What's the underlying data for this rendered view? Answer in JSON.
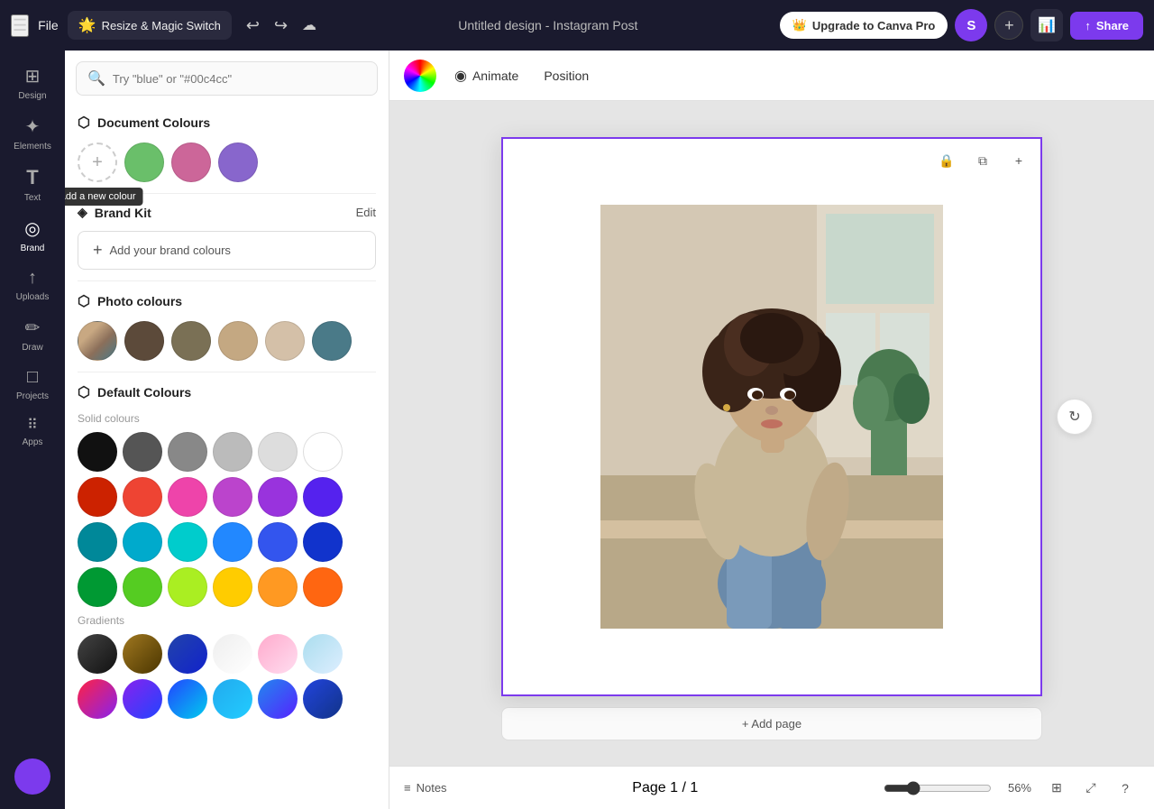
{
  "topbar": {
    "hamburger": "☰",
    "file_label": "File",
    "magic_switch_label": "Resize & Magic Switch",
    "magic_switch_emoji": "🌟",
    "undo_icon": "↩",
    "redo_icon": "↪",
    "cloud_icon": "☁",
    "title": "Untitled design - Instagram Post",
    "upgrade_label": "Upgrade to Canva Pro",
    "upgrade_crown": "👑",
    "avatar_letter": "S",
    "plus_icon": "+",
    "analytics_icon": "📊",
    "share_icon": "↑",
    "share_label": "Share"
  },
  "sidebar": {
    "items": [
      {
        "id": "design",
        "icon": "⊞",
        "label": "Design"
      },
      {
        "id": "elements",
        "icon": "✦",
        "label": "Elements"
      },
      {
        "id": "text",
        "icon": "T",
        "label": "Text"
      },
      {
        "id": "brand",
        "icon": "◎",
        "label": "Brand"
      },
      {
        "id": "uploads",
        "icon": "↑",
        "label": "Uploads"
      },
      {
        "id": "draw",
        "icon": "✏",
        "label": "Draw"
      },
      {
        "id": "projects",
        "icon": "□",
        "label": "Projects"
      },
      {
        "id": "apps",
        "icon": "⋮⋮",
        "label": "Apps"
      }
    ]
  },
  "color_panel": {
    "search_placeholder": "Try \"blue\" or \"#00c4cc\"",
    "document_colours_label": "Document Colours",
    "document_colors": [
      {
        "id": "dc1",
        "color": "#6abf6a",
        "label": "Green"
      },
      {
        "id": "dc2",
        "color": "#cc6699",
        "label": "Pink"
      },
      {
        "id": "dc3",
        "color": "#8866cc",
        "label": "Purple"
      }
    ],
    "add_color_tooltip": "Add a new colour",
    "brand_kit_label": "Brand Kit",
    "edit_label": "Edit",
    "add_brand_label": "Add your brand colours",
    "photo_colours_label": "Photo colours",
    "photo_colors": [
      {
        "id": "pc1",
        "color": "#7a5c4a",
        "label": "Dark Brown"
      },
      {
        "id": "pc2",
        "color": "#5c4a3a",
        "label": "Brown"
      },
      {
        "id": "pc3",
        "color": "#7a7055",
        "label": "Olive"
      },
      {
        "id": "pc4",
        "color": "#c4a882",
        "label": "Tan"
      },
      {
        "id": "pc5",
        "color": "#d4c0a8",
        "label": "Light Tan"
      },
      {
        "id": "pc6",
        "color": "#4a7a88",
        "label": "Teal"
      }
    ],
    "default_colours_label": "Default Colours",
    "solid_label": "Solid colours",
    "solid_colors_row1": [
      "#111111",
      "#555555",
      "#888888",
      "#bbbbbb",
      "#dddddd",
      "#ffffff"
    ],
    "solid_colors_row2": [
      "#cc2200",
      "#ee4433",
      "#ee44aa",
      "#bb44cc",
      "#9933dd",
      "#5522ee"
    ],
    "solid_colors_row3": [
      "#008899",
      "#00aacc",
      "#00cccc",
      "#2288ff",
      "#3355ee",
      "#1133cc"
    ],
    "solid_colors_row4": [
      "#009933",
      "#55cc22",
      "#aaee22",
      "#ffcc00",
      "#ff9922",
      "#ff6611"
    ],
    "gradients_label": "Gradients",
    "gradient_colors": [
      {
        "id": "g1",
        "from": "#333333",
        "to": "#111111"
      },
      {
        "id": "g2",
        "from": "#8B6914",
        "to": "#4a3500"
      },
      {
        "id": "g3",
        "from": "#2244aa",
        "to": "#1122cc"
      },
      {
        "id": "g4",
        "from": "#dddddd",
        "to": "#ffffff"
      },
      {
        "id": "g5",
        "from": "#ffaacc",
        "to": "#ffddee"
      },
      {
        "id": "g6",
        "from": "#aaddee",
        "to": "#ddeeff"
      }
    ],
    "gradient_colors_row2": [
      {
        "id": "g7",
        "from": "#ff2244",
        "to": "#8822ee"
      },
      {
        "id": "g8",
        "from": "#8822ee",
        "to": "#2244ff"
      },
      {
        "id": "g9",
        "from": "#2244ff",
        "to": "#00ccee"
      },
      {
        "id": "g10",
        "from": "#22aaee",
        "to": "#22ccff"
      },
      {
        "id": "g11",
        "from": "#2288ee",
        "to": "#5522ff"
      },
      {
        "id": "g12",
        "from": "#2244dd",
        "to": "#113388"
      }
    ]
  },
  "canvas": {
    "animate_label": "Animate",
    "position_label": "Position",
    "animate_icon": "◉"
  },
  "bottom_bar": {
    "notes_icon": "≡",
    "notes_label": "Notes",
    "page_label": "Page 1 / 1",
    "zoom_value": 56,
    "zoom_label": "56%",
    "view_grid_icon": "⊞",
    "view_expand_icon": "⤢",
    "view_help_icon": "?"
  },
  "add_page_label": "+ Add page"
}
